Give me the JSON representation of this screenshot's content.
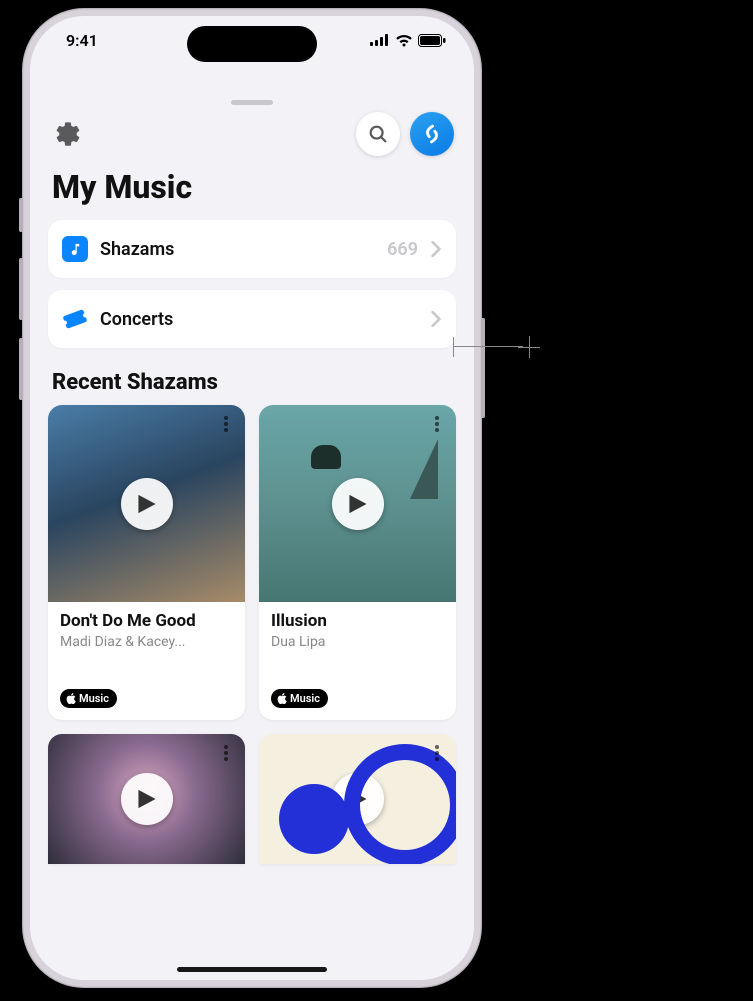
{
  "status": {
    "time": "9:41"
  },
  "header": {
    "title": "My Music"
  },
  "rows": {
    "shazams": {
      "label": "Shazams",
      "count": "669"
    },
    "concerts": {
      "label": "Concerts"
    }
  },
  "recent": {
    "heading": "Recent Shazams",
    "cards": [
      {
        "title": "Don't Do Me Good",
        "artist": "Madi Diaz & Kacey...",
        "badge": "Music"
      },
      {
        "title": "Illusion",
        "artist": "Dua Lipa",
        "badge": "Music"
      }
    ]
  }
}
